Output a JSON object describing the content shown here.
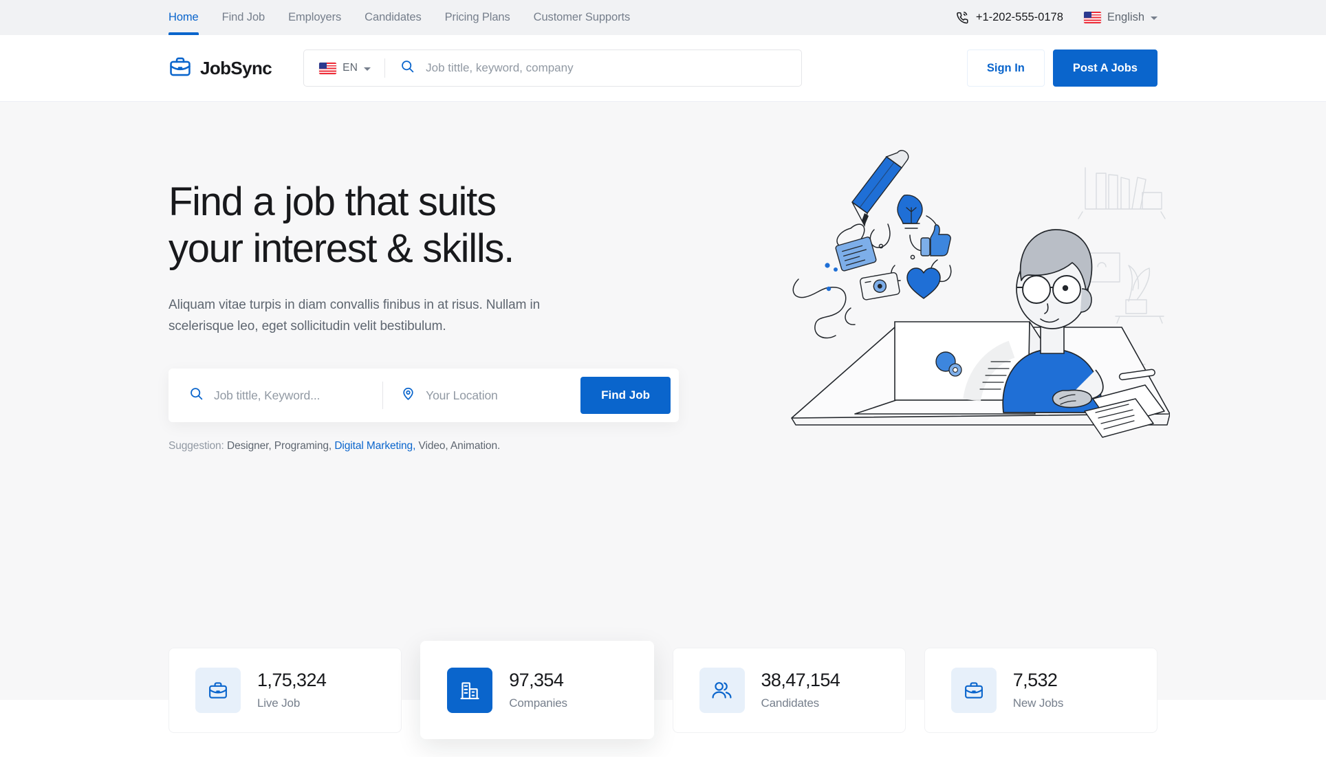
{
  "topbar": {
    "nav": [
      {
        "label": "Home",
        "active": true
      },
      {
        "label": "Find Job",
        "active": false
      },
      {
        "label": "Employers",
        "active": false
      },
      {
        "label": "Candidates",
        "active": false
      },
      {
        "label": "Pricing Plans",
        "active": false
      },
      {
        "label": "Customer Supports",
        "active": false
      }
    ],
    "phone": "+1-202-555-0178",
    "language": "English"
  },
  "header": {
    "logo_text": "JobSync",
    "lang_code": "EN",
    "search_placeholder": "Job tittle, keyword, company",
    "search_value": "",
    "sign_in_label": "Sign In",
    "post_job_label": "Post A Jobs"
  },
  "hero": {
    "title_line1": "Find a job that suits",
    "title_line2": "your interest & skills.",
    "subtitle": "Aliquam vitae turpis in diam convallis finibus in at risus. Nullam in scelerisque leo, eget sollicitudin velit bestibulum.",
    "keyword_placeholder": "Job tittle, Keyword...",
    "keyword_value": "",
    "location_placeholder": "Your Location",
    "location_value": "",
    "find_job_label": "Find Job",
    "suggestion_label": "Suggestion:",
    "suggestion_items": "Designer, Programing,",
    "suggestion_link": "Digital Marketing,",
    "suggestion_rest": "Video, Animation."
  },
  "stats": [
    {
      "value": "1,75,324",
      "label": "Live Job",
      "icon": "briefcase-icon",
      "featured": false
    },
    {
      "value": "97,354",
      "label": "Companies",
      "icon": "building-icon",
      "featured": true
    },
    {
      "value": "38,47,154",
      "label": "Candidates",
      "icon": "users-icon",
      "featured": false
    },
    {
      "value": "7,532",
      "label": "New Jobs",
      "icon": "briefcase-icon",
      "featured": false
    }
  ],
  "colors": {
    "accent": "#0A65CC",
    "accent_soft": "#E7F0FA",
    "topbar_bg": "#F1F2F4",
    "hero_bg": "#F7F7F8",
    "text_dark": "#18191C",
    "text_muted": "#767F8C"
  }
}
